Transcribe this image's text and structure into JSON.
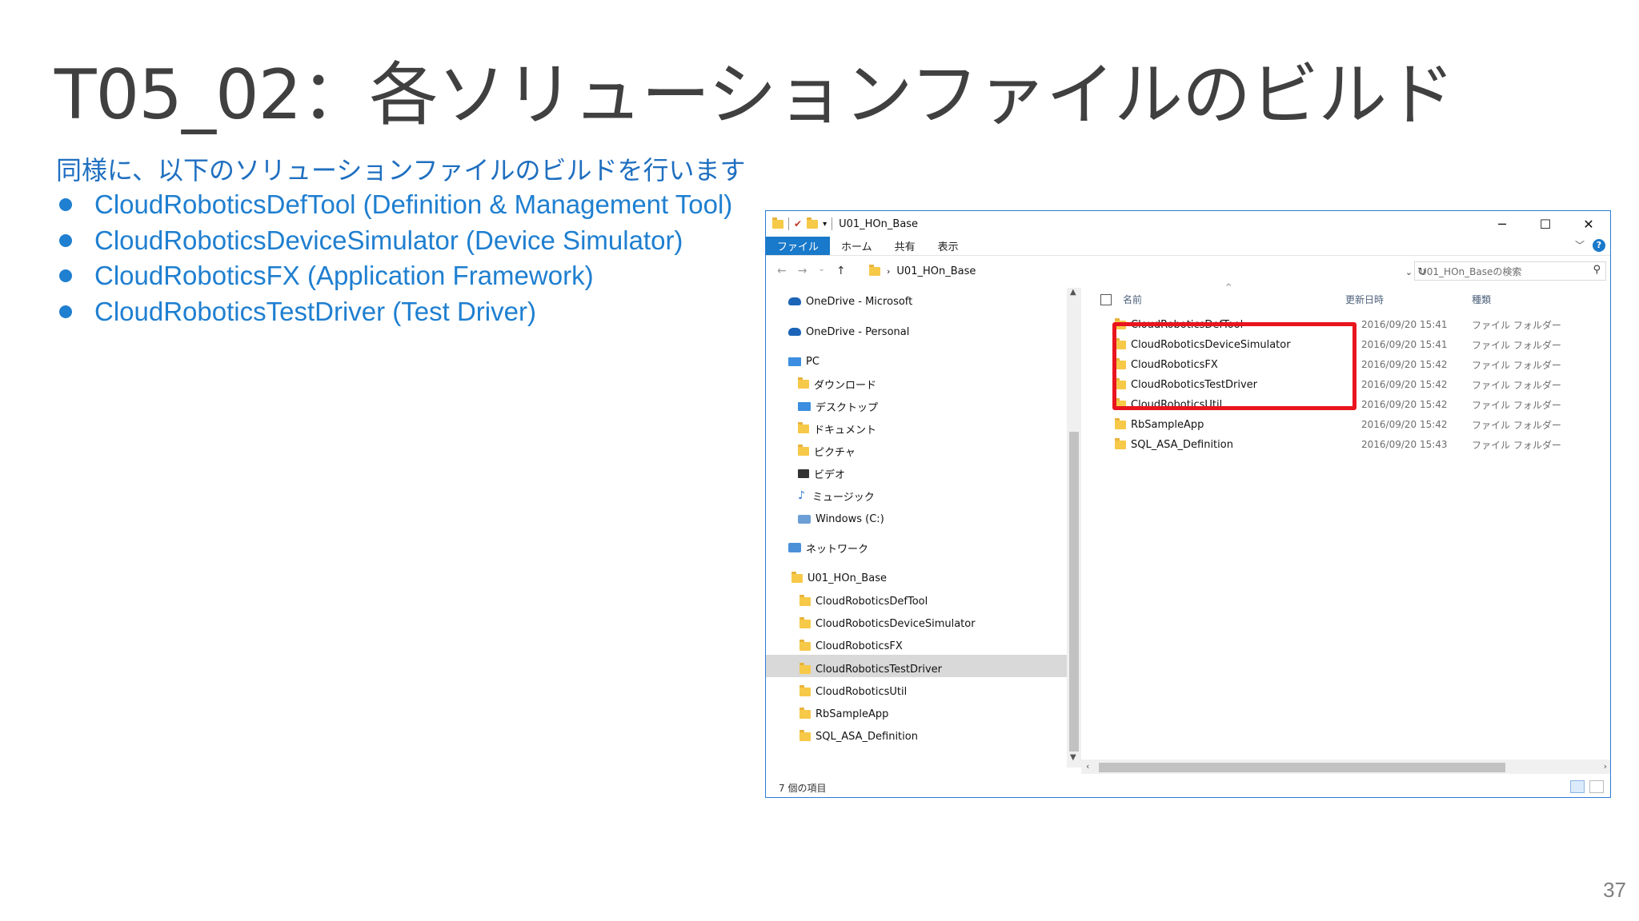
{
  "slide": {
    "title": "T05_02：各ソリューションファイルのビルド",
    "subtitle": "同様に、以下のソリューションファイルのビルドを行います",
    "bullets": [
      "CloudRoboticsDefTool (Definition & Management Tool)",
      "CloudRoboticsDeviceSimulator (Device Simulator)",
      "CloudRoboticsFX (Application Framework)",
      "CloudRoboticsTestDriver (Test Driver)"
    ],
    "page_number": "37",
    "accent_color": "#1f7fd0",
    "highlight_color": "#e8141e"
  },
  "explorer": {
    "title": "U01_HOn_Base",
    "ribbon_tabs": [
      "ファイル",
      "ホーム",
      "共有",
      "表示"
    ],
    "address": {
      "path": "U01_HOn_Base",
      "search_placeholder": "U01_HOn_Baseの検索"
    },
    "nav": {
      "onedrive_ms": "OneDrive - Microsoft",
      "onedrive_personal": "OneDrive - Personal",
      "pc": "PC",
      "pc_items": [
        "ダウンロード",
        "デスクトップ",
        "ドキュメント",
        "ピクチャ",
        "ビデオ",
        "ミュージック",
        "Windows (C:)"
      ],
      "network": "ネットワーク",
      "selected_folder": "U01_HOn_Base",
      "subfolders": [
        "CloudRoboticsDefTool",
        "CloudRoboticsDeviceSimulator",
        "CloudRoboticsFX",
        "CloudRoboticsTestDriver",
        "CloudRoboticsUtil",
        "RbSampleApp",
        "SQL_ASA_Definition"
      ]
    },
    "columns": {
      "name": "名前",
      "date": "更新日時",
      "type": "種類"
    },
    "files": [
      {
        "name": "CloudRoboticsDefTool",
        "date": "2016/09/20 15:41",
        "type": "ファイル フォルダー"
      },
      {
        "name": "CloudRoboticsDeviceSimulator",
        "date": "2016/09/20 15:41",
        "type": "ファイル フォルダー"
      },
      {
        "name": "CloudRoboticsFX",
        "date": "2016/09/20 15:42",
        "type": "ファイル フォルダー"
      },
      {
        "name": "CloudRoboticsTestDriver",
        "date": "2016/09/20 15:42",
        "type": "ファイル フォルダー"
      },
      {
        "name": "CloudRoboticsUtil",
        "date": "2016/09/20 15:42",
        "type": "ファイル フォルダー"
      },
      {
        "name": "RbSampleApp",
        "date": "2016/09/20 15:42",
        "type": "ファイル フォルダー"
      },
      {
        "name": "SQL_ASA_Definition",
        "date": "2016/09/20 15:43",
        "type": "ファイル フォルダー"
      }
    ],
    "status": "7 個の項目"
  }
}
